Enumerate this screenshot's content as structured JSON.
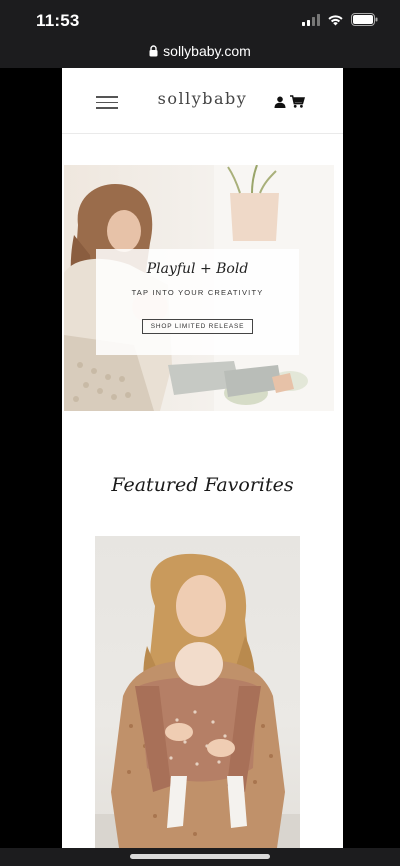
{
  "status_bar": {
    "time": "11:53"
  },
  "browser": {
    "url": "sollybaby.com"
  },
  "site": {
    "logo": "sollybaby"
  },
  "hero": {
    "title": "Playful + Bold",
    "subtitle": "TAP INTO YOUR CREATIVITY",
    "button_label": "SHOP LIMITED RELEASE"
  },
  "featured": {
    "title": "Featured Favorites"
  },
  "icons": {
    "signal": "cellular-signal-icon",
    "wifi": "wifi-icon",
    "battery": "battery-icon",
    "lock": "lock-icon",
    "menu": "hamburger-menu-icon",
    "account": "user-account-icon",
    "cart": "shopping-cart-icon"
  },
  "colors": {
    "status_bar_bg": "#1c1c1e",
    "carrier_wrap": "#b57f66",
    "page_bg": "#ffffff"
  }
}
